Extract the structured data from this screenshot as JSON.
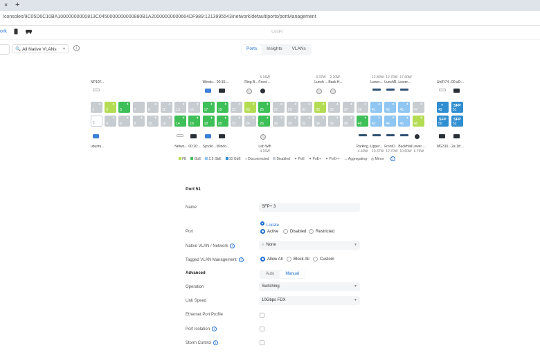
{
  "browser": {
    "close_glyph": "×",
    "new_tab_glyph": "+",
    "url": "/consoles/9C05D6C10BA10000000000813C0450000000000880B1A20000000000664DF989:1213995543/network/default/ports/portManagement"
  },
  "header": {
    "nav_label": "ork",
    "brand": "UniFi"
  },
  "filters": {
    "vlan_prefix": "🔍",
    "vlan_value": "All Native VLANs",
    "info_glyph": "i"
  },
  "tabs": [
    {
      "label": "Ports",
      "active": true
    },
    {
      "label": "Insights",
      "active": false
    },
    {
      "label": "VLANs",
      "active": false
    }
  ],
  "devices_top": [
    {
      "name": "NP10F...",
      "power": "",
      "col": 1,
      "kind": "white"
    },
    {
      "name": "Windo...",
      "power": "",
      "col": 9,
      "kind": "blue"
    },
    {
      "name": "00:15:...",
      "power": "",
      "col": 10,
      "kind": "dark"
    },
    {
      "name": "Ring B...",
      "power": "",
      "col": 12,
      "kind": "round"
    },
    {
      "name": "Front ...",
      "power": "5.16W",
      "col": 13,
      "kind": "cam"
    },
    {
      "name": "Lunch ...",
      "power": "3.37W",
      "col": 17,
      "kind": "dome"
    },
    {
      "name": "Back H...",
      "power": "2.20W",
      "col": 18,
      "kind": "dome"
    },
    {
      "name": "Lower...",
      "power": "12.80W",
      "col": 21,
      "kind": "flat"
    },
    {
      "name": "LunchR...",
      "power": "12.70W",
      "col": 22,
      "kind": "flat"
    },
    {
      "name": "Lower...",
      "power": "17.60W",
      "col": 23,
      "kind": "flat"
    },
    {
      "name": "UniFi74...",
      "power": "",
      "col": 25,
      "kind": "white"
    },
    {
      "name": "00:a0:...",
      "power": "",
      "col": 26,
      "kind": "dark"
    }
  ],
  "devices_bottom": [
    {
      "name": "ubuntu...",
      "power": "",
      "col": 1,
      "kind": "blue"
    },
    {
      "name": "Netwo...",
      "power": "",
      "col": 7,
      "kind": "white"
    },
    {
      "name": "00:20:...",
      "power": "",
      "col": 8,
      "kind": "dark"
    },
    {
      "name": "Synolo...",
      "power": "",
      "col": 9,
      "kind": "blue"
    },
    {
      "name": "Windo...",
      "power": "",
      "col": 10,
      "kind": "dark"
    },
    {
      "name": "Lab Wifi",
      "power": "4.16W",
      "col": 13,
      "kind": "round"
    },
    {
      "name": "Parking...",
      "power": "4.40W",
      "col": 20,
      "kind": "flat"
    },
    {
      "name": "Upper...",
      "power": "10.37W",
      "col": 21,
      "kind": "flat"
    },
    {
      "name": "FrontO...",
      "power": "12.70W",
      "col": 22,
      "kind": "flat"
    },
    {
      "name": "BackHall",
      "power": "10.60W",
      "col": 23,
      "kind": "flat"
    },
    {
      "name": "Lower ...",
      "power": "6.79W",
      "col": 24,
      "kind": "cam"
    },
    {
      "name": "MG316...",
      "power": "",
      "col": 25,
      "kind": "dark"
    },
    {
      "name": "2a:1d:...",
      "power": "",
      "col": 26,
      "kind": "dark"
    }
  ],
  "ports_top": [
    {
      "n": "1",
      "s": "dis",
      "poe": true
    },
    {
      "n": "3",
      "s": "fe",
      "poe": true
    },
    {
      "n": "5",
      "s": "ge",
      "poe": true
    },
    {
      "n": "7",
      "s": "dis",
      "poe": false
    },
    {
      "n": "9",
      "s": "dis",
      "poe": true
    },
    {
      "n": "11",
      "s": "dis",
      "poe": true
    },
    {
      "n": "13",
      "s": "dis",
      "poe": true
    },
    {
      "n": "15",
      "s": "dis",
      "poe": true
    },
    {
      "n": "17",
      "s": "ge",
      "poe": true
    },
    {
      "n": "19",
      "s": "ge",
      "poe": true
    },
    {
      "n": "21",
      "s": "dis",
      "poe": true
    },
    {
      "n": "23",
      "s": "fe",
      "poe": true
    },
    {
      "n": "25",
      "s": "ge",
      "poe": true
    },
    {
      "n": "27",
      "s": "dis",
      "poe": true
    },
    {
      "n": "29",
      "s": "dis",
      "poe": true
    },
    {
      "n": "31",
      "s": "dis",
      "poe": true
    },
    {
      "n": "33",
      "s": "fe",
      "poe": true
    },
    {
      "n": "35",
      "s": "dis",
      "poe": true
    },
    {
      "n": "37",
      "s": "dis",
      "poe": true
    },
    {
      "n": "39",
      "s": "dis",
      "poe": true
    },
    {
      "n": "41",
      "s": "25",
      "poe": true
    },
    {
      "n": "43",
      "s": "25",
      "poe": true
    },
    {
      "n": "45",
      "s": "25",
      "poe": true
    },
    {
      "n": "47",
      "s": "dis",
      "poe": true
    },
    {
      "n": "49",
      "s": "10",
      "poe": false,
      "top": "^"
    },
    {
      "n": "51",
      "s": "10",
      "poe": false,
      "sfp": "SFP"
    }
  ],
  "ports_bottom": [
    {
      "n": "2",
      "s": "empty",
      "poe": false
    },
    {
      "n": "4",
      "s": "dis",
      "poe": true
    },
    {
      "n": "6",
      "s": "dis",
      "poe": true
    },
    {
      "n": "8",
      "s": "dis",
      "poe": true
    },
    {
      "n": "10",
      "s": "dis",
      "poe": true
    },
    {
      "n": "12",
      "s": "dis",
      "poe": true
    },
    {
      "n": "14",
      "s": "ge",
      "poe": true
    },
    {
      "n": "16",
      "s": "ge",
      "poe": true
    },
    {
      "n": "18",
      "s": "ge",
      "poe": true
    },
    {
      "n": "20",
      "s": "ge",
      "poe": true
    },
    {
      "n": "22",
      "s": "dis",
      "poe": true
    },
    {
      "n": "24",
      "s": "dis",
      "poe": true
    },
    {
      "n": "26",
      "s": "ge",
      "poe": true
    },
    {
      "n": "28",
      "s": "dis",
      "poe": true
    },
    {
      "n": "30",
      "s": "dis",
      "poe": true
    },
    {
      "n": "32",
      "s": "dis",
      "poe": true
    },
    {
      "n": "34",
      "s": "dis",
      "poe": true
    },
    {
      "n": "36",
      "s": "dis",
      "poe": true
    },
    {
      "n": "38",
      "s": "dis",
      "poe": true
    },
    {
      "n": "40",
      "s": "ge",
      "poe": true
    },
    {
      "n": "42",
      "s": "25",
      "poe": true
    },
    {
      "n": "44",
      "s": "25",
      "poe": true
    },
    {
      "n": "46",
      "s": "25",
      "poe": true
    },
    {
      "n": "48",
      "s": "fe",
      "poe": true
    },
    {
      "n": "50",
      "s": "10",
      "poe": false,
      "sfp": "SFP"
    },
    {
      "n": "52",
      "s": "10",
      "poe": false,
      "sfp": "SFP"
    }
  ],
  "legend": [
    {
      "label": "FE",
      "color": "#b4dc52"
    },
    {
      "label": "GbE",
      "color": "#3fbf57"
    },
    {
      "label": "2.5 GbE",
      "color": "#8fc6f2"
    },
    {
      "label": "10 GbE",
      "color": "#2f8dd0"
    },
    {
      "label": "○ Disconnected",
      "color": ""
    },
    {
      "label": "Disabled",
      "color": "#c7ccd1"
    },
    {
      "label": "✦ PoE",
      "color": ""
    },
    {
      "label": "✦ PoE+",
      "color": ""
    },
    {
      "label": "✦ PoE++",
      "color": ""
    },
    {
      "label": "↔ Aggregating",
      "color": ""
    },
    {
      "label": "◎ Mirror",
      "color": ""
    }
  ],
  "form": {
    "title": "Port 51",
    "name_label": "Name",
    "name_value": "SFP+ 3",
    "locate": "Locate",
    "port_label": "Port",
    "port_opts": [
      "Active",
      "Disabled",
      "Restricted"
    ],
    "native_label": "Native VLAN / Network",
    "native_value": "None",
    "tagged_label": "Tagged VLAN Management",
    "tagged_opts": [
      "Allow All",
      "Block All",
      "Custom"
    ],
    "advanced_label": "Advanced",
    "advanced_opts": [
      "Auto",
      "Manual"
    ],
    "operation_label": "Operation",
    "operation_value": "Switching",
    "speed_label": "Link Speed",
    "speed_value": "10Gbps FDX",
    "profile_label": "Ethernet Port Profile",
    "isolation_label": "Port Isolation",
    "storm_label": "Storm Control",
    "info_glyph": "i"
  },
  "colors": {
    "accent": "#1f6fd0",
    "fe": "#b4dc52",
    "ge": "#3fbf57",
    "g25": "#8fc6f2",
    "g10": "#2f8dd0",
    "disabled": "#c7ccd1"
  }
}
